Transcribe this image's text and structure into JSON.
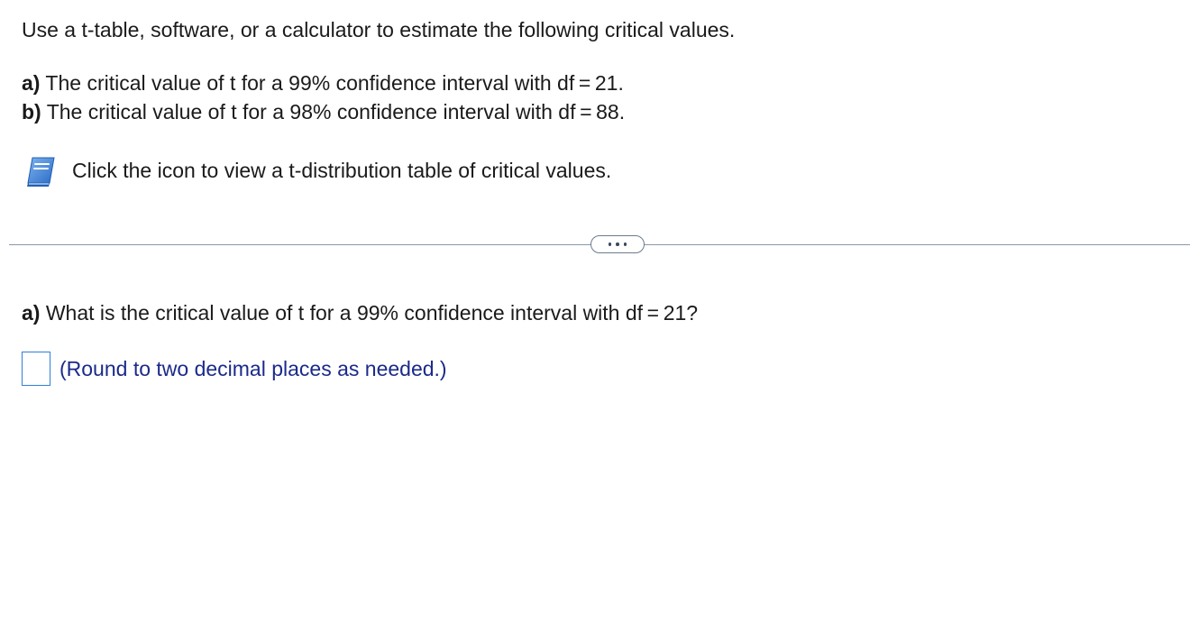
{
  "intro": {
    "text": "Use a t-table, software, or a calculator to estimate the following critical values."
  },
  "parts": [
    {
      "label": "a)",
      "text": " The critical value of t for a 99% confidence interval with df = 21."
    },
    {
      "label": "b)",
      "text": " The critical value of t for a 98% confidence interval with df = 88."
    }
  ],
  "table_link": {
    "icon": "book-icon",
    "text": "Click the icon to view a t-distribution table of critical values."
  },
  "divider": {
    "more_icon": "ellipsis-icon"
  },
  "question": {
    "label": "a)",
    "text": " What is the critical value of t for a 99% confidence interval with df = 21?"
  },
  "answer": {
    "value": "",
    "hint": "(Round to two decimal places as needed.)"
  },
  "colors": {
    "icon_blue": "#3a7fd4",
    "input_border": "#2f7fd8",
    "hint_text": "#1b2a8a",
    "divider": "#8a97a8"
  }
}
